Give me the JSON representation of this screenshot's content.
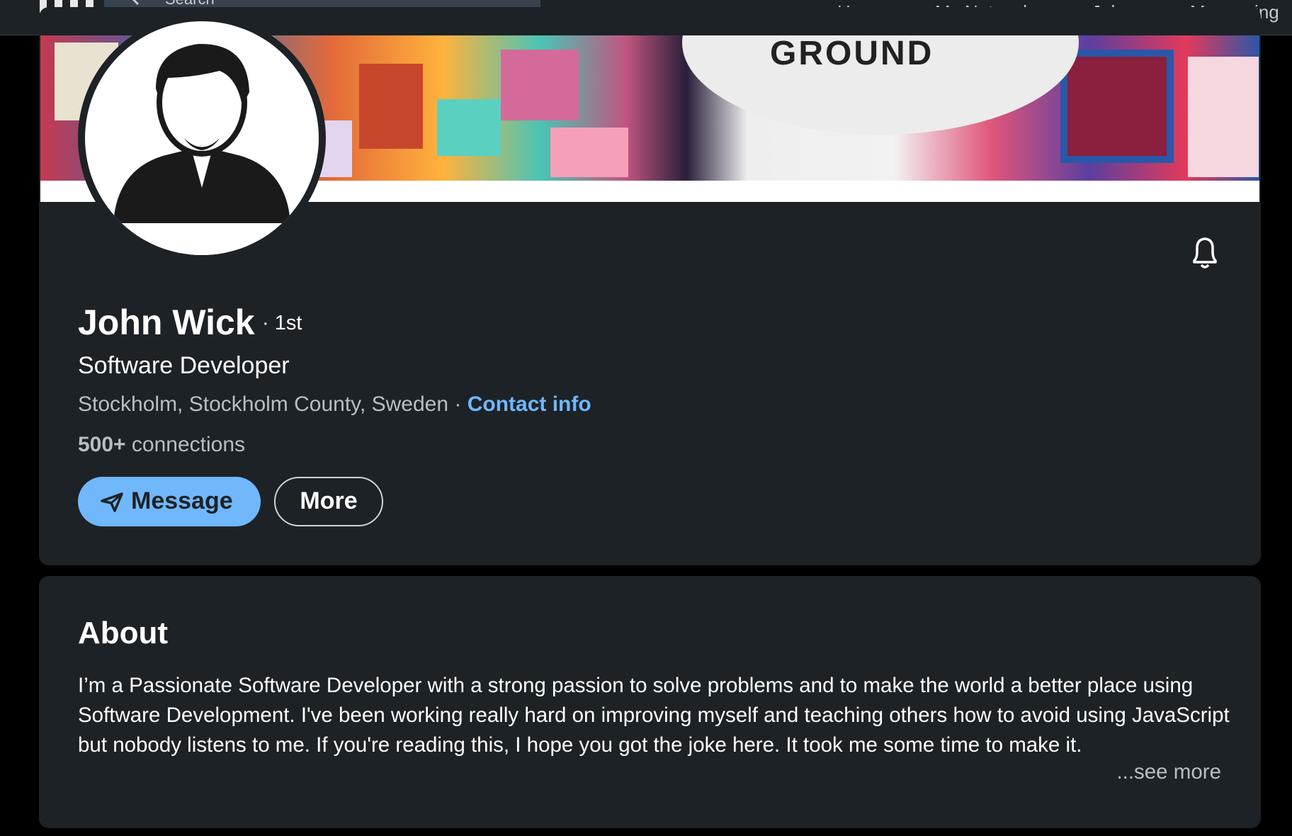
{
  "topbar": {
    "search_placeholder": "Search",
    "nav": [
      "Home",
      "My Network",
      "Jobs",
      "Messaging"
    ]
  },
  "banner": {
    "word": "GROUND"
  },
  "profile": {
    "name": "John Wick",
    "degree": "· 1st",
    "headline": "Software Developer",
    "location": "Stockholm, Stockholm County, Sweden",
    "location_sep": " · ",
    "contact_info": "Contact info",
    "connections_count": "500+",
    "connections_label": " connections",
    "message_label": "Message",
    "more_label": "More"
  },
  "about": {
    "title": "About",
    "text": "I’m a Passionate Software Developer with a strong passion to solve problems and to make the world a better place using Software Development. I've been working really hard on improving myself and teaching others how to avoid using JavaScript but nobody listens to me. If you're reading this, I hope you got the joke here. It took me some time to make it.",
    "see_more": "...see more"
  },
  "colors": {
    "background": "#000000",
    "card": "#1d2226",
    "accent": "#71b7fb",
    "muted_text": "#b8bec4"
  },
  "icons": [
    "linkedin-logo-icon",
    "search-icon",
    "bell-icon",
    "send-icon",
    "avatar-silhouette-icon"
  ]
}
